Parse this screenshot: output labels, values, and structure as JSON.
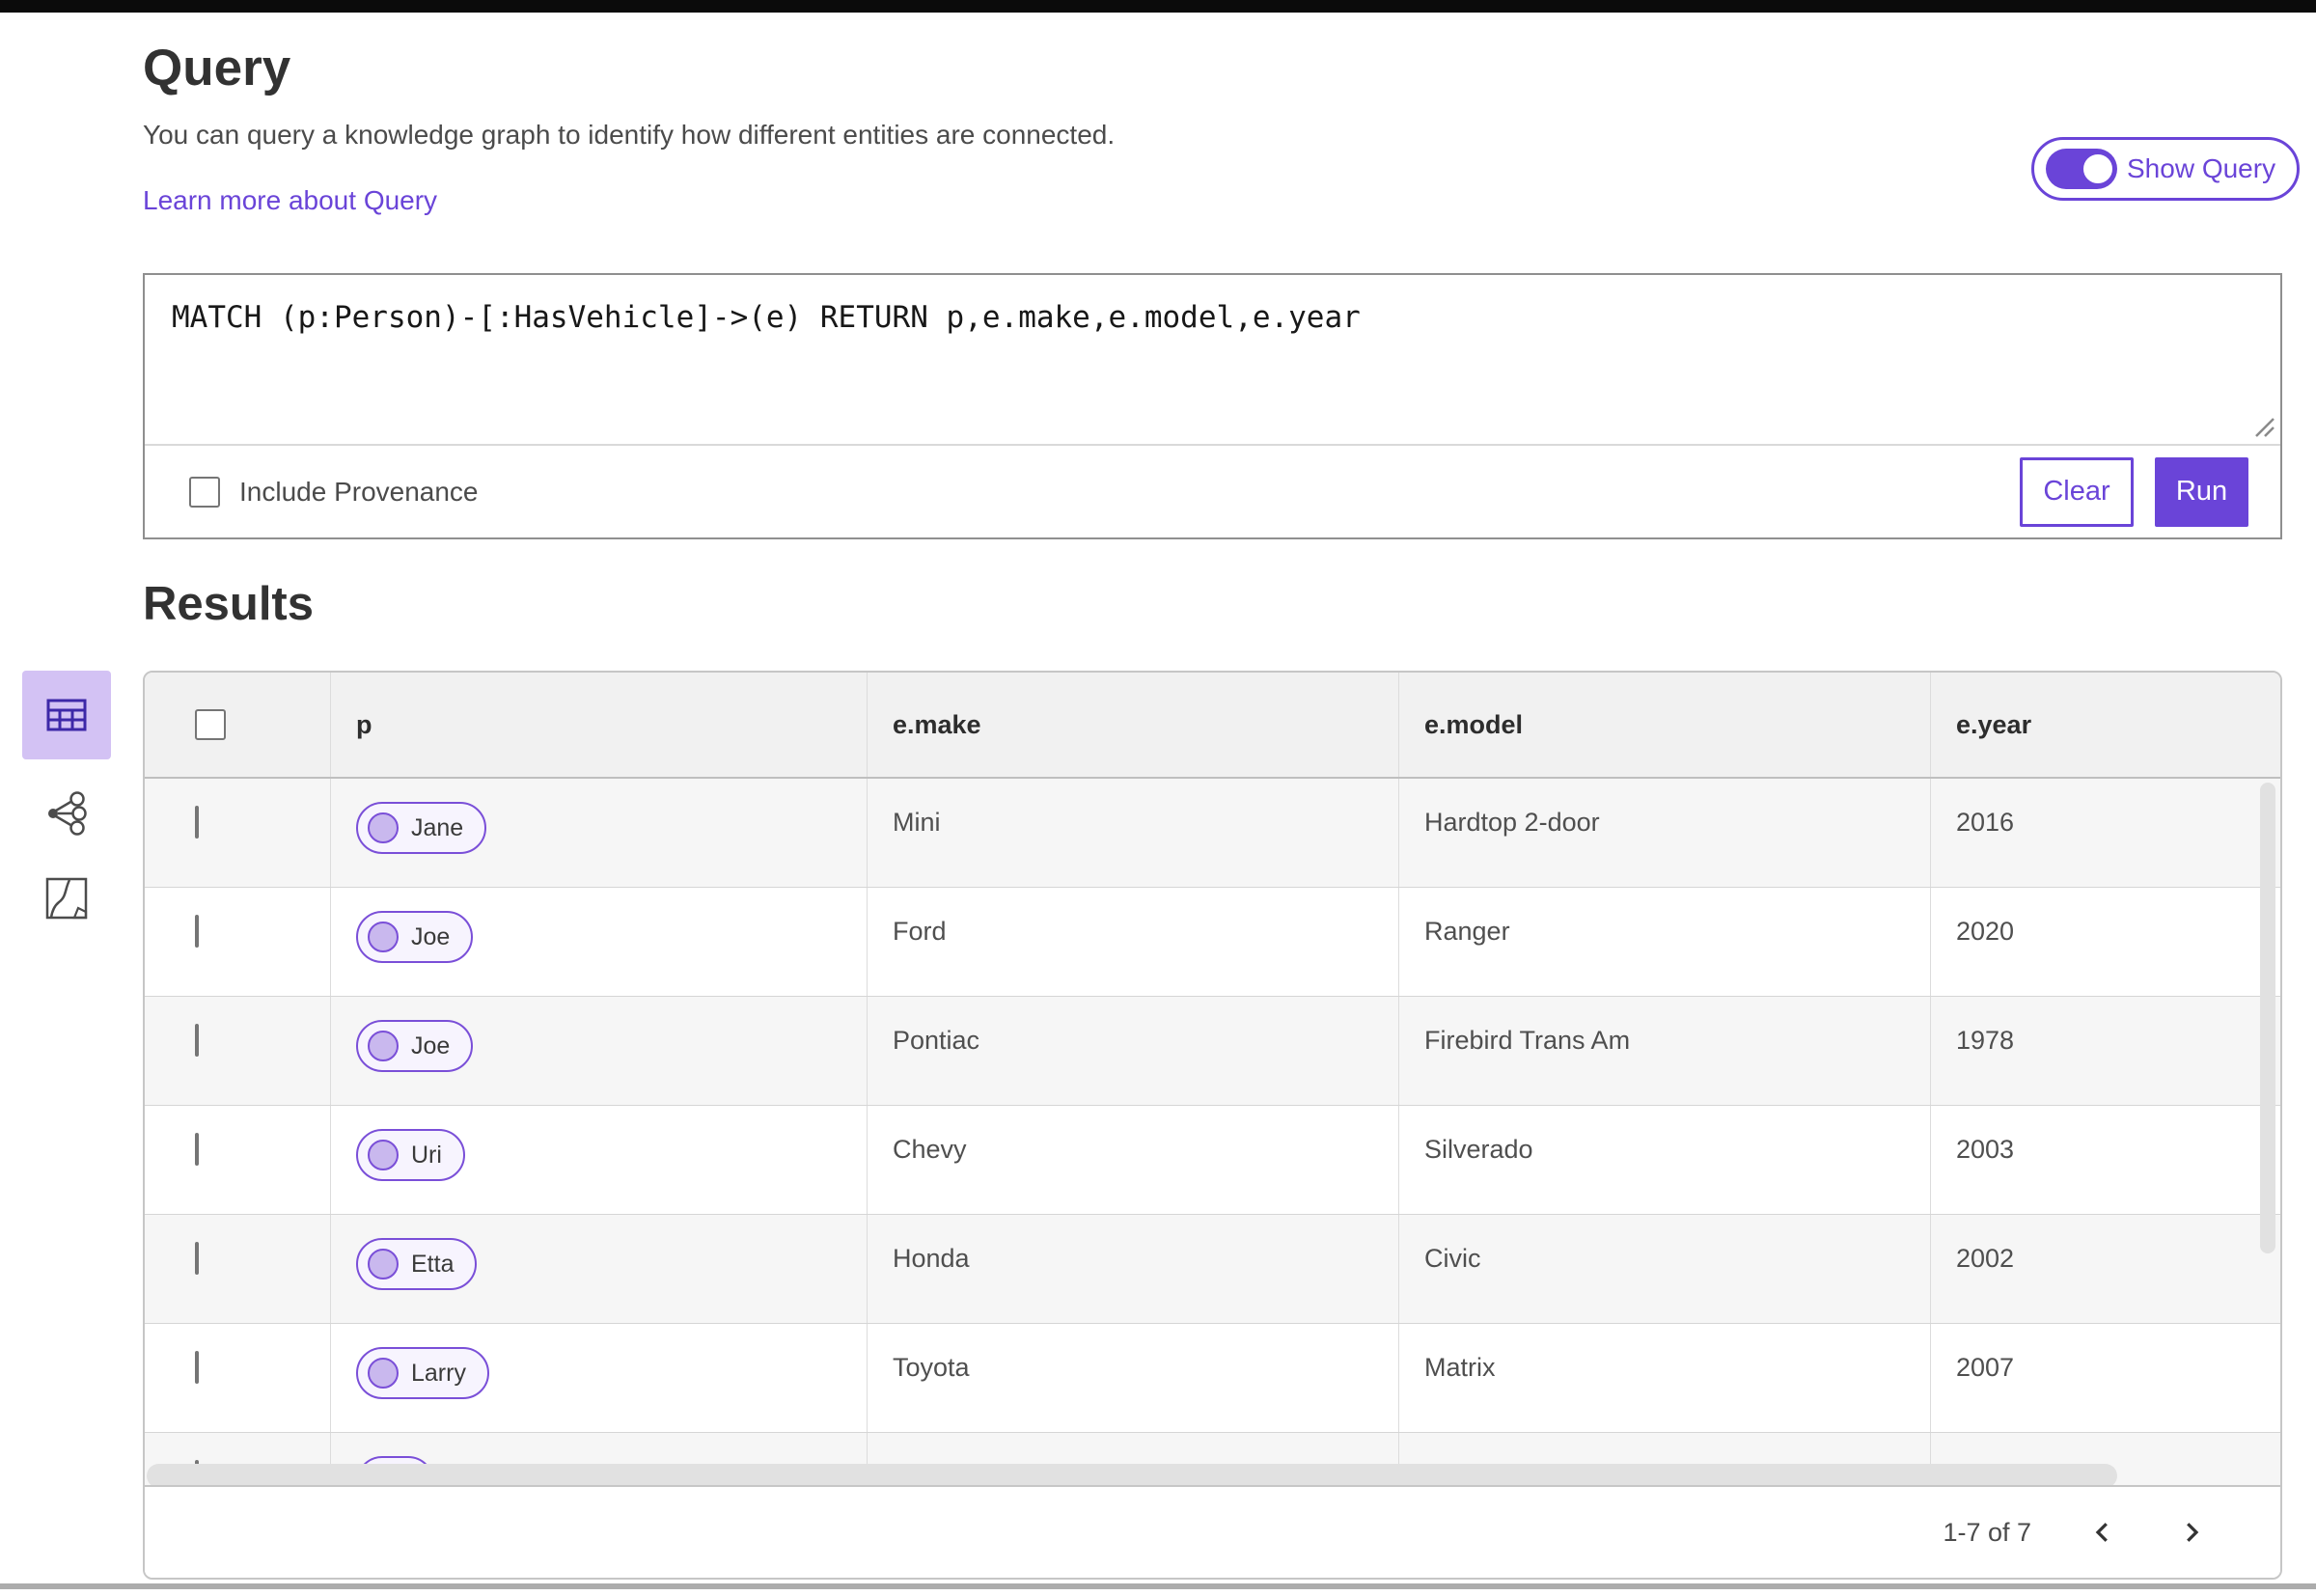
{
  "query_panel": {
    "title": "Query",
    "description": "You can query a knowledge graph to identify how different entities are connected.",
    "learn_more_link": "Learn more about Query",
    "show_query_toggle": {
      "label": "Show Query",
      "state": "on"
    },
    "query_text": "MATCH (p:Person)-[:HasVehicle]->(e) RETURN p,e.make,e.model,e.year",
    "include_provenance": {
      "label": "Include Provenance",
      "checked": false
    },
    "clear_button": "Clear",
    "run_button": "Run"
  },
  "results_panel": {
    "title": "Results",
    "view_switcher": [
      {
        "name": "table-view",
        "active": true
      },
      {
        "name": "link-chart-view",
        "active": false
      },
      {
        "name": "map-view",
        "active": false
      }
    ],
    "table": {
      "columns": [
        "p",
        "e.make",
        "e.model",
        "e.year"
      ],
      "rows": [
        {
          "p": "Jane",
          "e_make": "Mini",
          "e_model": "Hardtop 2-door",
          "e_year": "2016"
        },
        {
          "p": "Joe",
          "e_make": "Ford",
          "e_model": "Ranger",
          "e_year": "2020"
        },
        {
          "p": "Joe",
          "e_make": "Pontiac",
          "e_model": "Firebird Trans Am",
          "e_year": "1978"
        },
        {
          "p": "Uri",
          "e_make": "Chevy",
          "e_model": "Silverado",
          "e_year": "2003"
        },
        {
          "p": "Etta",
          "e_make": "Honda",
          "e_model": "Civic",
          "e_year": "2002"
        },
        {
          "p": "Larry",
          "e_make": "Toyota",
          "e_model": "Matrix",
          "e_year": "2007"
        }
      ],
      "partial_last_row_visible": true
    },
    "pagination": {
      "range_label": "1-7 of 7"
    }
  },
  "colors": {
    "accent_purple": "#6a44d8",
    "active_tile_bg": "#d3c2f4",
    "pill_fill": "#f7f4fe",
    "pill_circle": "#c9b8ee",
    "table_header_bg": "#f1f1f1",
    "row_alt_bg": "#f6f6f6"
  }
}
